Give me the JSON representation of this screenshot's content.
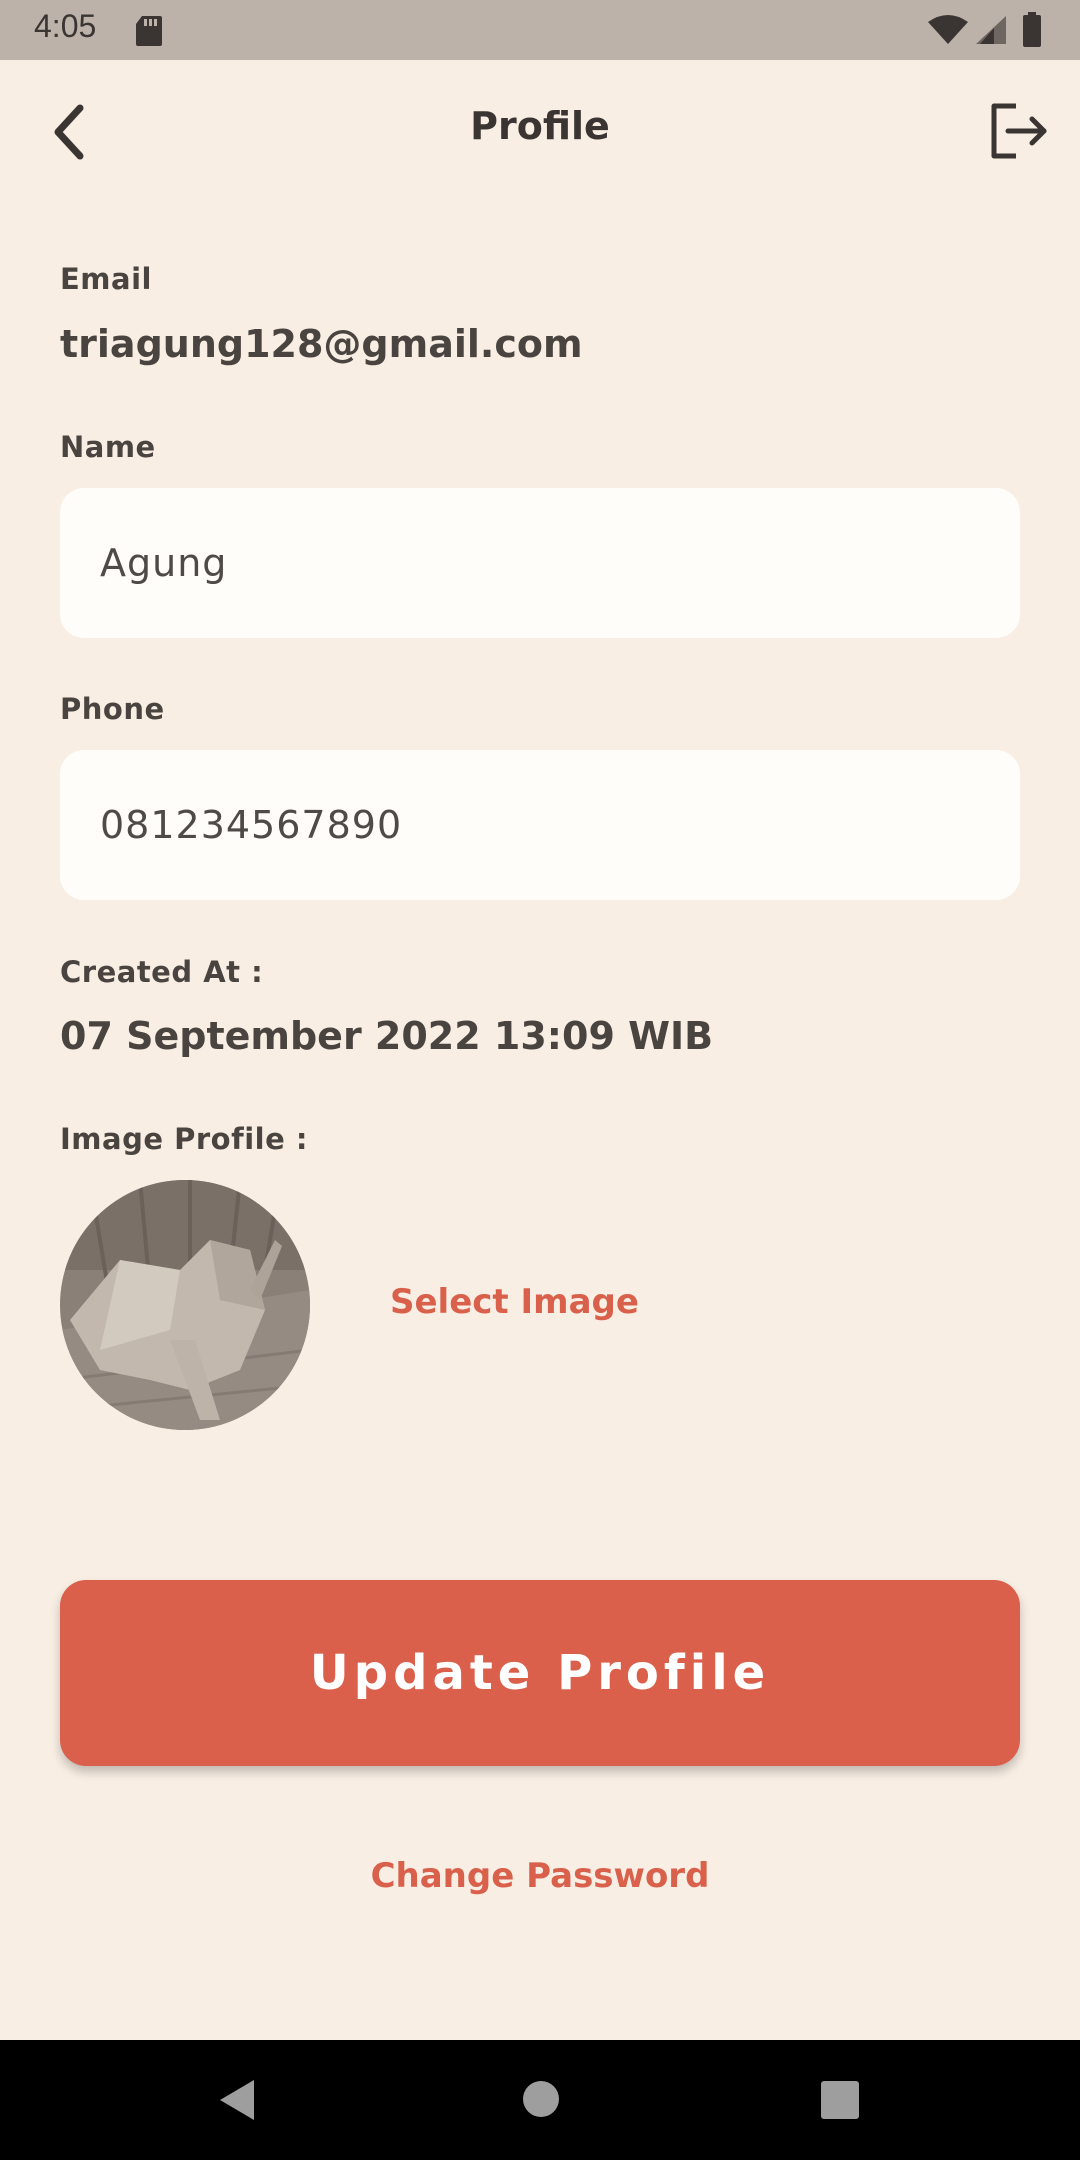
{
  "status_bar": {
    "time": "4:05",
    "icons": [
      "sd-card-icon",
      "wifi-icon",
      "signal-icon",
      "battery-icon"
    ]
  },
  "app_bar": {
    "title": "Profile",
    "back_icon": "chevron-left-icon",
    "logout_icon": "logout-icon"
  },
  "form": {
    "email_label": "Email",
    "email_value": "triagung128@gmail.com",
    "name_label": "Name",
    "name_value": "Agung",
    "phone_label": "Phone",
    "phone_value": "081234567890",
    "created_label": "Created At :",
    "created_value": "07 September 2022 13:09 WIB",
    "image_label": "Image Profile :",
    "select_image_label": "Select Image"
  },
  "actions": {
    "update_label": "Update Profile",
    "change_password_label": "Change Password"
  },
  "colors": {
    "background": "#F8EEE4",
    "accent": "#DB604C",
    "input_bg": "#FFFDF9",
    "text": "#4A4440"
  },
  "nav_bar": {
    "icons": [
      "nav-back-icon",
      "nav-home-icon",
      "nav-recents-icon"
    ]
  }
}
